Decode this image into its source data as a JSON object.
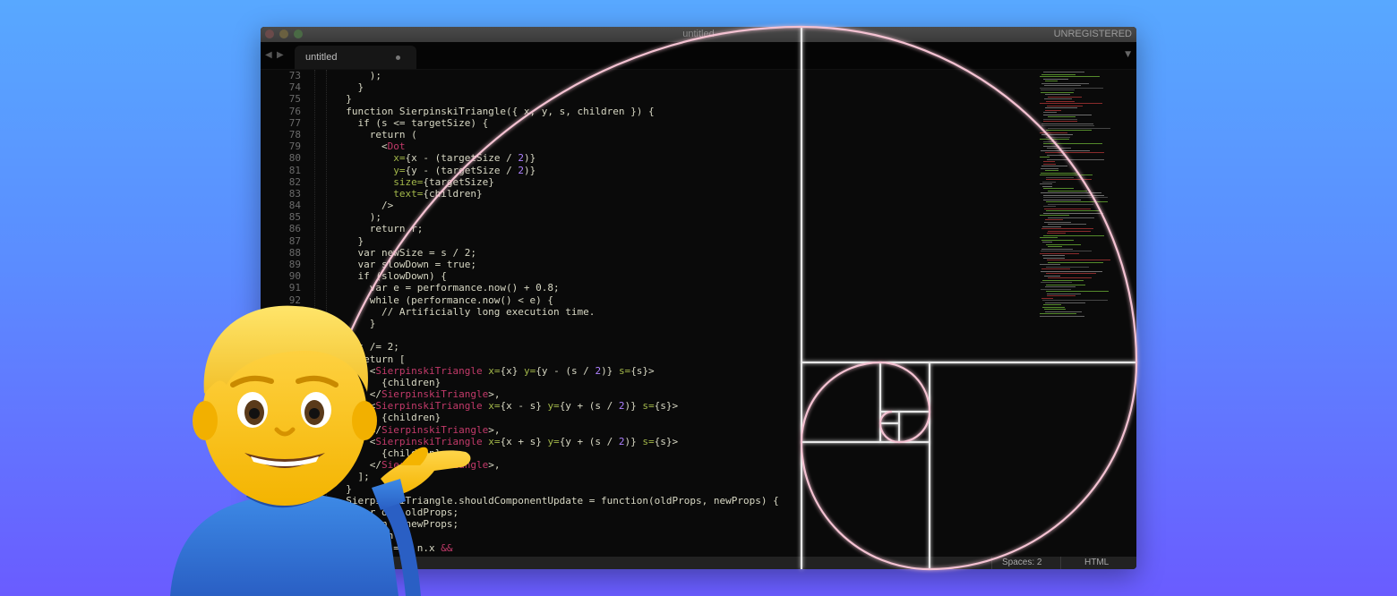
{
  "window": {
    "title": "untitled",
    "license_text": "UNREGISTERED"
  },
  "tab": {
    "label": "untitled"
  },
  "nav": {
    "back_glyph": "◀",
    "forward_glyph": "▶",
    "menu_glyph": "▼"
  },
  "code": {
    "line_numbers": [
      "73",
      "74",
      "75",
      "76",
      "77",
      "78",
      "79",
      "80",
      "81",
      "82",
      "83",
      "84",
      "85",
      "86",
      "87",
      "88",
      "89",
      "90",
      "91",
      "92"
    ],
    "lines": [
      "      );",
      "    }",
      "  }",
      "  function SierpinskiTriangle({ x, y, s, children }) {",
      "    if (s <= targetSize) {",
      "      return (",
      "        <Dot",
      "          x={x - (targetSize / 2)}",
      "          y={y - (targetSize / 2)}",
      "          size={targetSize}",
      "          text={children}",
      "        />",
      "      );",
      "      return r;",
      "    }",
      "    var newSize = s / 2;",
      "    var slowDown = true;",
      "    if (slowDown) {",
      "      var e = performance.now() + 0.8;",
      "      while (performance.now() < e) {",
      "        // Artificially long execution time.",
      "      }",
      "",
      "    s /= 2;",
      "    return [",
      "      <SierpinskiTriangle x={x} y={y - (s / 2)} s={s}>",
      "        {children}",
      "      </SierpinskiTriangle>,",
      "      <SierpinskiTriangle x={x - s} y={y + (s / 2)} s={s}>",
      "        {children}",
      "      </SierpinskiTriangle>,",
      "      <SierpinskiTriangle x={x + s} y={y + (s / 2)} s={s}>",
      "        {children}",
      "      </SierpinskiTriangle>,",
      "    ];",
      "  }",
      "  SierpinskiTriangle.shouldComponentUpdate = function(oldProps, newProps) {",
      "    var o = oldProps;",
      "    var n = newProps;",
      "    return !(",
      "      o.x === n.x &&"
    ]
  },
  "status": {
    "spaces": "Spaces: 2",
    "syntax": "HTML"
  },
  "colors": {
    "background_top": "#58a8ff",
    "background_bottom": "#6a5cff",
    "editor_bg": "#0a0a0a",
    "keyword_pink": "#c33a6a",
    "attr_green": "#a3b84a",
    "number_purple": "#ae81ff",
    "spiral_glow": "#ffd0e0"
  },
  "icons": {
    "close": "window-close-icon",
    "minimize": "window-minimize-icon",
    "maximize": "window-maximize-icon",
    "overlay": "person-tipping-hand-icon"
  }
}
